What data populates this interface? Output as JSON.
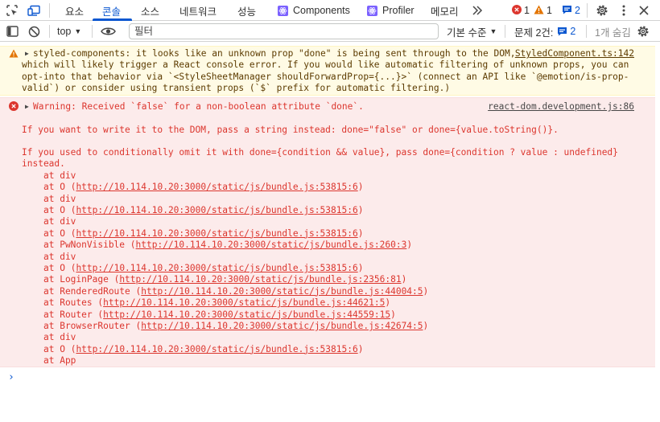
{
  "tabs": [
    {
      "label": "요소",
      "active": false
    },
    {
      "label": "콘솔",
      "active": true
    },
    {
      "label": "소스",
      "active": false
    },
    {
      "label": "네트워크",
      "active": false
    },
    {
      "label": "성능",
      "active": false
    },
    {
      "label": "Components",
      "active": false,
      "icon": "react-icon"
    },
    {
      "label": "Profiler",
      "active": false,
      "icon": "react-icon"
    },
    {
      "label": "메모리",
      "active": false
    }
  ],
  "more_tabs_icon": "chevron-double-right-icon",
  "status": {
    "errors": "1",
    "warnings": "1",
    "issues": "2"
  },
  "toolbar": {
    "context": "top",
    "filter_placeholder": "필터",
    "levels": "기본 수준",
    "issues_label": "문제 2건:",
    "issues_count": "2",
    "hidden": "1개 숨김"
  },
  "warning": {
    "source": "StyledComponent.ts:142",
    "lines": [
      "styled-components: it looks like an unknown prop \"done\" is being sent through to the DOM,",
      "which will likely trigger a React console error. If you would like automatic filtering of unknown props, you can",
      "opt-into that behavior via `<StyleSheetManager shouldForwardProp={...}>` (connect an API like `@emotion/is-prop-",
      "valid`) or consider using transient props (`$` prefix for automatic filtering.)"
    ]
  },
  "error": {
    "source": "react-dom.development.js:86",
    "headline": "Warning: Received `false` for a non-boolean attribute `done`.",
    "hint1": "If you want to write it to the DOM, pass a string instead: done=\"false\" or done={value.toString()}.",
    "hint2a": "If you used to conditionally omit it with done={condition && value}, pass done={condition ? value : undefined}",
    "hint2b": "instead.",
    "stack": [
      {
        "fn": "at div",
        "url": ""
      },
      {
        "fn": "at O",
        "url": "http://10.114.10.20:3000/static/js/bundle.js:53815:6"
      },
      {
        "fn": "at div",
        "url": ""
      },
      {
        "fn": "at O",
        "url": "http://10.114.10.20:3000/static/js/bundle.js:53815:6"
      },
      {
        "fn": "at div",
        "url": ""
      },
      {
        "fn": "at O",
        "url": "http://10.114.10.20:3000/static/js/bundle.js:53815:6"
      },
      {
        "fn": "at PwNonVisible",
        "url": "http://10.114.10.20:3000/static/js/bundle.js:260:3"
      },
      {
        "fn": "at div",
        "url": ""
      },
      {
        "fn": "at O",
        "url": "http://10.114.10.20:3000/static/js/bundle.js:53815:6"
      },
      {
        "fn": "at LoginPage",
        "url": "http://10.114.10.20:3000/static/js/bundle.js:2356:81"
      },
      {
        "fn": "at RenderedRoute",
        "url": "http://10.114.10.20:3000/static/js/bundle.js:44004:5"
      },
      {
        "fn": "at Routes",
        "url": "http://10.114.10.20:3000/static/js/bundle.js:44621:5"
      },
      {
        "fn": "at Router",
        "url": "http://10.114.10.20:3000/static/js/bundle.js:44559:15"
      },
      {
        "fn": "at BrowserRouter",
        "url": "http://10.114.10.20:3000/static/js/bundle.js:42674:5"
      },
      {
        "fn": "at div",
        "url": ""
      },
      {
        "fn": "at O",
        "url": "http://10.114.10.20:3000/static/js/bundle.js:53815:6"
      },
      {
        "fn": "at App",
        "url": ""
      }
    ]
  },
  "prompt": "›",
  "colors": {
    "accent": "#0b57d0",
    "error_text": "#dc362e",
    "error_bg": "#fcebeb",
    "warning_bg": "#fffbe5",
    "warning_text": "#5c3b00",
    "warning_icon": "#e37400"
  }
}
